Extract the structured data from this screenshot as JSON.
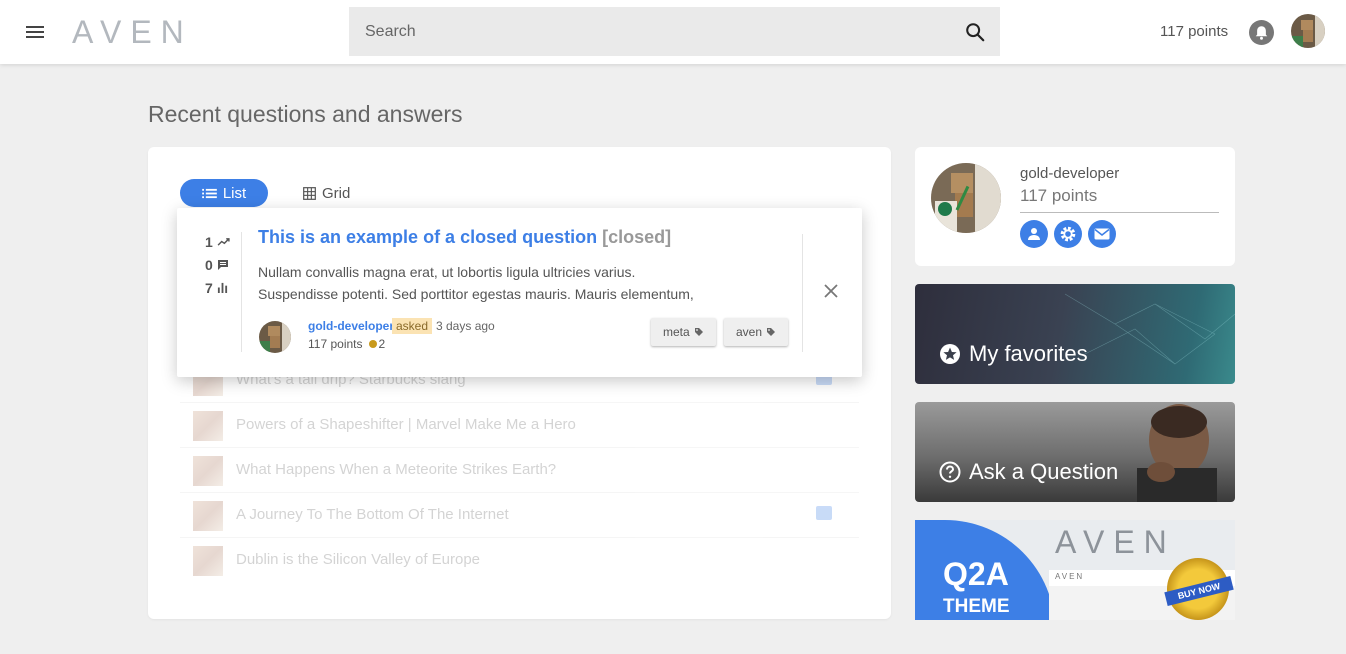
{
  "header": {
    "logo": "AVEN",
    "search_placeholder": "Search",
    "points": "117 points"
  },
  "page": {
    "title": "Recent questions and answers"
  },
  "view_tabs": {
    "list": "List",
    "grid": "Grid"
  },
  "featured_question": {
    "votes": "1",
    "answers": "0",
    "views": "7",
    "title": "This is an example of a closed question",
    "status": "[closed]",
    "body_line1": "Nullam convallis magna erat, ut lobortis ligula ultricies varius.",
    "body_line2": "Suspendisse potenti. Sed porttitor egestas mauris. Mauris elementum,",
    "user": "gold-developer",
    "action": "asked",
    "when": "3 days ago",
    "user_points": "117 points",
    "badge_count": "2",
    "tags": [
      "meta",
      "aven"
    ]
  },
  "questions": [
    {
      "title": "What's a tall drip? Starbucks slang",
      "has_answers": true
    },
    {
      "title": "Powers of a Shapeshifter | Marvel Make Me a Hero",
      "has_answers": false
    },
    {
      "title": "What Happens When a Meteorite Strikes Earth?",
      "has_answers": false
    },
    {
      "title": "A Journey To The Bottom Of The Internet",
      "has_answers": true
    },
    {
      "title": "Dublin is the Silicon Valley of Europe",
      "has_answers": false
    }
  ],
  "profile": {
    "name": "gold-developer",
    "points": "117 points"
  },
  "sidebar": {
    "favorites_label": "My favorites",
    "ask_label": "Ask a Question"
  },
  "promo": {
    "q2a": "Q2A",
    "theme": "THEME",
    "logo": "AVEN",
    "strip_text": "AVEN",
    "badge": "BUY NOW"
  },
  "colors": {
    "accent": "#3d7fe6",
    "closed": "#999999",
    "asked_badge": "#fbe3b3",
    "gold": "#c99a1c"
  }
}
